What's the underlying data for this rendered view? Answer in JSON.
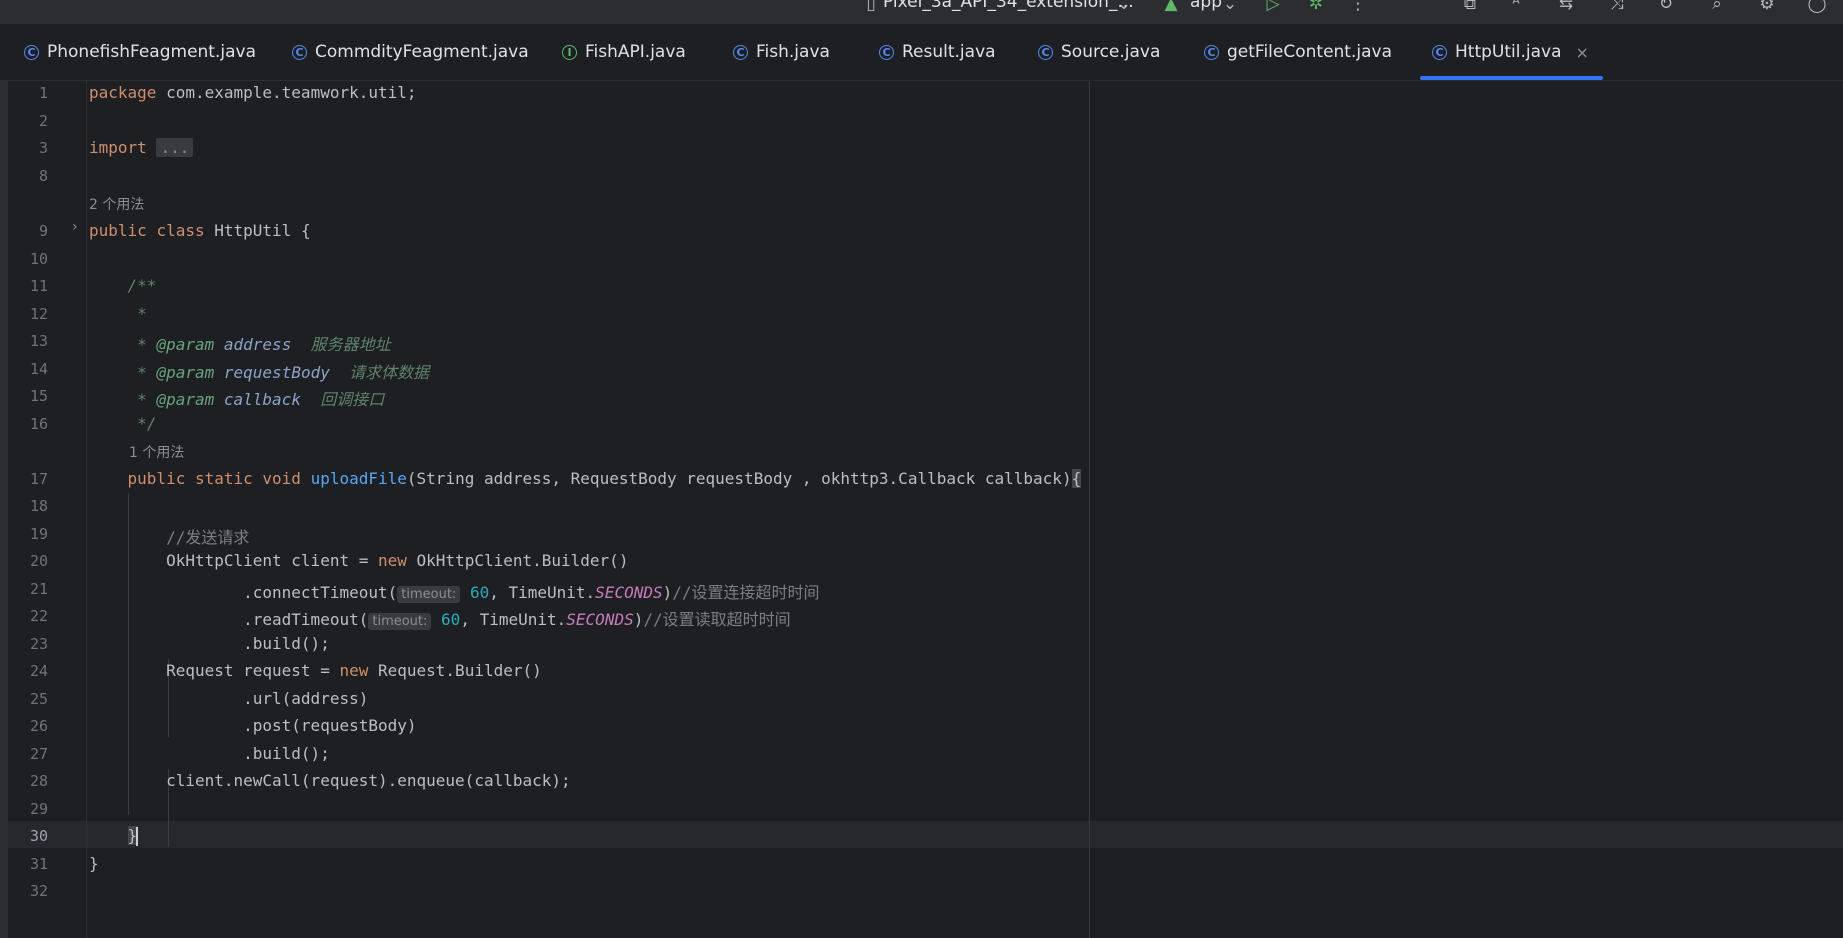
{
  "toolbar": {
    "device": "Pixel_3a_API_34_extension_...",
    "run_config": "app",
    "icons": [
      "device-icon",
      "android-icon",
      "run-icon",
      "debug-icon",
      "more-icon",
      "build-icon",
      "translate-icon",
      "diff-icon",
      "sync-icon",
      "project-sync-icon",
      "search-icon",
      "settings-icon",
      "account-icon"
    ]
  },
  "tabs": [
    {
      "label": "PhonefishFeagment.java",
      "kind": "class"
    },
    {
      "label": "CommdityFeagment.java",
      "kind": "class"
    },
    {
      "label": "FishAPI.java",
      "kind": "interface"
    },
    {
      "label": "Fish.java",
      "kind": "class"
    },
    {
      "label": "Result.java",
      "kind": "class"
    },
    {
      "label": "Source.java",
      "kind": "class"
    },
    {
      "label": "getFileContent.java",
      "kind": "class"
    },
    {
      "label": "HttpUtil.java",
      "kind": "class",
      "active": true
    }
  ],
  "tab_icon": {
    "class": "C",
    "interface": "I",
    "close": "×"
  },
  "editor": {
    "current_line": "30",
    "line_numbers": [
      "1",
      "2",
      "3",
      "8",
      "9",
      "10",
      "11",
      "12",
      "13",
      "14",
      "15",
      "16",
      "17",
      "18",
      "19",
      "20",
      "21",
      "22",
      "23",
      "24",
      "25",
      "26",
      "27",
      "28",
      "29",
      "30",
      "31",
      "32"
    ],
    "usage_hints": [
      "2 个用法",
      "1 个用法"
    ],
    "code": {
      "package_kw": "package",
      "package_name": " com.example.teamwork.util;",
      "import_kw": "import",
      "import_fold": "...",
      "public_kw": "public",
      "class_kw": "class",
      "class_name": " HttpUtil {",
      "doc_open": "/**",
      "doc_star": "*",
      "doc_param": "@param",
      "param1": "address",
      "param1_desc": "服务器地址",
      "param2": "requestBody",
      "param2_desc": "请求体数据",
      "param3": "callback",
      "param3_desc": "回调接口",
      "doc_close": "*/",
      "static_kw": "static",
      "void_kw": "void",
      "method_name": "uploadFile",
      "method_params": "(String address, RequestBody requestBody , okhttp3.Callback callback)",
      "brace_open": "{",
      "comment_send": "//发送请求",
      "client_decl": "OkHttpClient client = ",
      "new_kw": "new",
      "builder1": " OkHttpClient.Builder()",
      "connect": ".connectTimeout(",
      "timeout_hint": "timeout:",
      "timeout_val": "60",
      "timeunit": ", TimeUnit.",
      "seconds": "SECONDS",
      "comment_connect": "//设置连接超时时间",
      "read": ".readTimeout(",
      "comment_read": "//设置读取超时时间",
      "build_call": ".build();",
      "request_decl": "Request request = ",
      "builder2": " Request.Builder()",
      "url_call": ".url(address)",
      "post_call": ".post(requestBody)",
      "enqueue": "client.newCall(request).enqueue(callback);",
      "brace_close": "}"
    }
  }
}
